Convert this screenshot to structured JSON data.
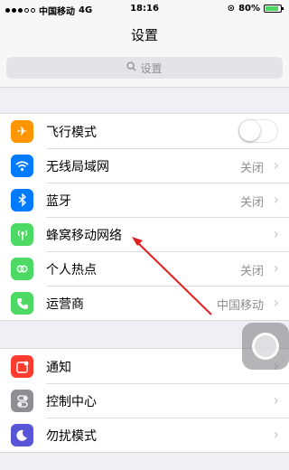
{
  "status": {
    "carrier": "中国移动",
    "network": "4G",
    "time": "18:16",
    "battery_percent": "80%",
    "battery_level": 0.8
  },
  "nav": {
    "title": "设置"
  },
  "search": {
    "placeholder": "设置"
  },
  "groups": [
    {
      "rows": [
        {
          "label": "飞行模式",
          "icon": "airplane-icon",
          "color": "#ff9500",
          "toggle": false
        },
        {
          "label": "无线局域网",
          "icon": "wifi-icon",
          "color": "#007aff",
          "value": "关闭"
        },
        {
          "label": "蓝牙",
          "icon": "bluetooth-icon",
          "color": "#007aff",
          "value": "关闭"
        },
        {
          "label": "蜂窝移动网络",
          "icon": "cellular-icon",
          "color": "#4cd964"
        },
        {
          "label": "个人热点",
          "icon": "hotspot-icon",
          "color": "#4cd964",
          "value": "关闭"
        },
        {
          "label": "运营商",
          "icon": "phone-icon",
          "color": "#4cd964",
          "value": "中国移动"
        }
      ]
    },
    {
      "rows": [
        {
          "label": "通知",
          "icon": "notifications-icon",
          "color": "#ff3b30"
        },
        {
          "label": "控制中心",
          "icon": "control-center-icon",
          "color": "#8e8e93"
        },
        {
          "label": "勿扰模式",
          "icon": "moon-icon",
          "color": "#5856d6"
        }
      ]
    }
  ]
}
